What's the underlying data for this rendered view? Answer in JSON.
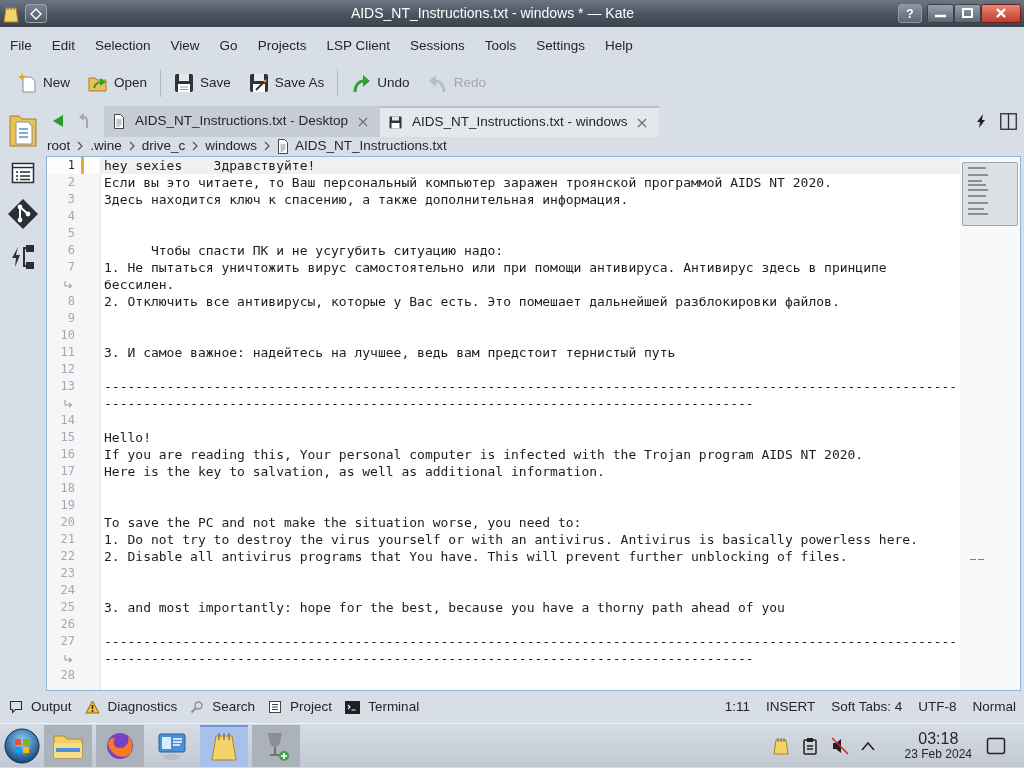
{
  "window": {
    "title": "AIDS_NT_Instructions.txt - windows * — Kate",
    "help": "?"
  },
  "menu": [
    "File",
    "Edit",
    "Selection",
    "View",
    "Go",
    "Projects",
    "LSP Client",
    "Sessions",
    "Tools",
    "Settings",
    "Help"
  ],
  "toolbar": [
    {
      "items": [
        {
          "kind": "new",
          "label": "New",
          "disabled": false
        },
        {
          "kind": "open",
          "label": "Open",
          "disabled": false
        }
      ]
    },
    {
      "items": [
        {
          "kind": "save",
          "label": "Save",
          "disabled": false
        },
        {
          "kind": "save_as",
          "label": "Save As",
          "disabled": false
        }
      ]
    },
    {
      "items": [
        {
          "kind": "undo",
          "label": "Undo",
          "disabled": false
        },
        {
          "kind": "redo",
          "label": "Redo",
          "disabled": true
        }
      ]
    }
  ],
  "sidebar": [
    {
      "kind": "documents"
    },
    {
      "kind": "symbols"
    },
    {
      "kind": "git"
    },
    {
      "kind": "lsp"
    }
  ],
  "navigation": [
    {
      "kind": "back",
      "disabled": false
    },
    {
      "kind": "forward",
      "disabled": true
    }
  ],
  "tabs": [
    {
      "label": "AIDS_NT_Instructions.txt - Desktop",
      "modified": false,
      "selected": false
    },
    {
      "label": "AIDS_NT_Instructions.txt - windows",
      "modified": true,
      "selected": true
    }
  ],
  "breadcrumb": [
    {
      "label": "root",
      "kind": "folder"
    },
    {
      "label": ".wine",
      "kind": "folder"
    },
    {
      "label": "drive_c",
      "kind": "folder"
    },
    {
      "label": "windows",
      "kind": "folder"
    },
    {
      "label": "AIDS_NT_Instructions.txt",
      "kind": "file"
    }
  ],
  "editor": {
    "lines": [
      {
        "number": "1",
        "rows": [
          "hey sexies    Здравствуйте!"
        ],
        "current": true,
        "modified": true
      },
      {
        "number": "2",
        "rows": [
          "Если вы это читаете, то Ваш персональный компьютер заражен троянской программой AIDS NT 2020."
        ],
        "current": false,
        "modified": false
      },
      {
        "number": "3",
        "rows": [
          "Здесь находится ключ к спасению, а также дополнительная информация."
        ],
        "current": false,
        "modified": false
      },
      {
        "number": "4",
        "current": false,
        "modified": false
      },
      {
        "number": "5",
        "current": false,
        "modified": false
      },
      {
        "number": "6",
        "rows": [
          "      Чтобы спасти ПК и не усугубить ситуацию надо:"
        ],
        "current": false,
        "modified": false
      },
      {
        "number": "7",
        "rows": [
          "1. Не пытаться уничтожить вирус самостоятельно или при помощи антивируса. Антивирус здесь в принципе",
          "бессилен."
        ],
        "current": false,
        "modified": false
      },
      {
        "number": "8",
        "rows": [
          "2. Отключить все антивирусы, которые у Вас есть. Это помешает дальнейшей разблокировки файлов."
        ],
        "current": false,
        "modified": false
      },
      {
        "number": "9",
        "current": false,
        "modified": false
      },
      {
        "number": "10",
        "current": false,
        "modified": false
      },
      {
        "number": "11",
        "rows": [
          "3. И самое важное: надейтесь на лучшее, ведь вам предстоит тернистый путь"
        ],
        "current": false,
        "modified": false
      },
      {
        "number": "12",
        "current": false,
        "modified": false
      },
      {
        "number": "13",
        "rows": [
          "-------------------------------------------------------------------------------------------------------------",
          "-----------------------------------------------------------------------------------"
        ],
        "current": false,
        "modified": false
      },
      {
        "number": "14",
        "current": false,
        "modified": false
      },
      {
        "number": "15",
        "rows": [
          "Hello!"
        ],
        "current": false,
        "modified": false
      },
      {
        "number": "16",
        "rows": [
          "If you are reading this, Your personal computer is infected with the Trojan program AIDS NT 2020."
        ],
        "current": false,
        "modified": false
      },
      {
        "number": "17",
        "rows": [
          "Here is the key to salvation, as well as additional information."
        ],
        "current": false,
        "modified": false
      },
      {
        "number": "18",
        "current": false,
        "modified": false
      },
      {
        "number": "19",
        "current": false,
        "modified": false
      },
      {
        "number": "20",
        "rows": [
          "To save the PC and not make the situation worse, you need to:"
        ],
        "current": false,
        "modified": false
      },
      {
        "number": "21",
        "rows": [
          "1. Do not try to destroy the virus yourself or with an antivirus. Antivirus is basically powerless here."
        ],
        "current": false,
        "modified": false
      },
      {
        "number": "22",
        "rows": [
          "2. Disable all antivirus programs that You have. This will prevent further unblocking of files."
        ],
        "current": false,
        "modified": false
      },
      {
        "number": "23",
        "current": false,
        "modified": false
      },
      {
        "number": "24",
        "current": false,
        "modified": false
      },
      {
        "number": "25",
        "rows": [
          "3. and most importantly: hope for the best, because you have a thorny path ahead of you"
        ],
        "current": false,
        "modified": false
      },
      {
        "number": "26",
        "current": false,
        "modified": false
      },
      {
        "number": "27",
        "rows": [
          "-------------------------------------------------------------------------------------------------------------",
          "-----------------------------------------------------------------------------------"
        ],
        "current": false,
        "modified": false
      },
      {
        "number": "28",
        "current": false,
        "modified": false
      }
    ]
  },
  "tool_views": [
    {
      "kind": "output",
      "label": "Output"
    },
    {
      "kind": "diagnostics",
      "label": "Diagnostics"
    },
    {
      "kind": "search",
      "label": "Search"
    },
    {
      "kind": "project",
      "label": "Project"
    },
    {
      "kind": "terminal",
      "label": "Terminal"
    }
  ],
  "status_bar": [
    "1:11",
    "INSERT",
    "Soft Tabs: 4",
    "UTF-8",
    "Normal"
  ],
  "taskbar": {
    "apps": [
      {
        "kind": "files",
        "running": true,
        "selected": false
      },
      {
        "kind": "browser",
        "running": true,
        "selected": false
      },
      {
        "kind": "remote",
        "running": false,
        "selected": false
      },
      {
        "kind": "editor",
        "running": true,
        "selected": true
      },
      {
        "kind": "wine",
        "running": true,
        "selected": false
      }
    ],
    "tray": [
      {
        "kind": "notes"
      },
      {
        "kind": "clipboard"
      },
      {
        "kind": "volume_muted"
      },
      {
        "kind": "expand"
      }
    ],
    "clock": {
      "time": "03:18",
      "date": "23 Feb 2024"
    }
  }
}
